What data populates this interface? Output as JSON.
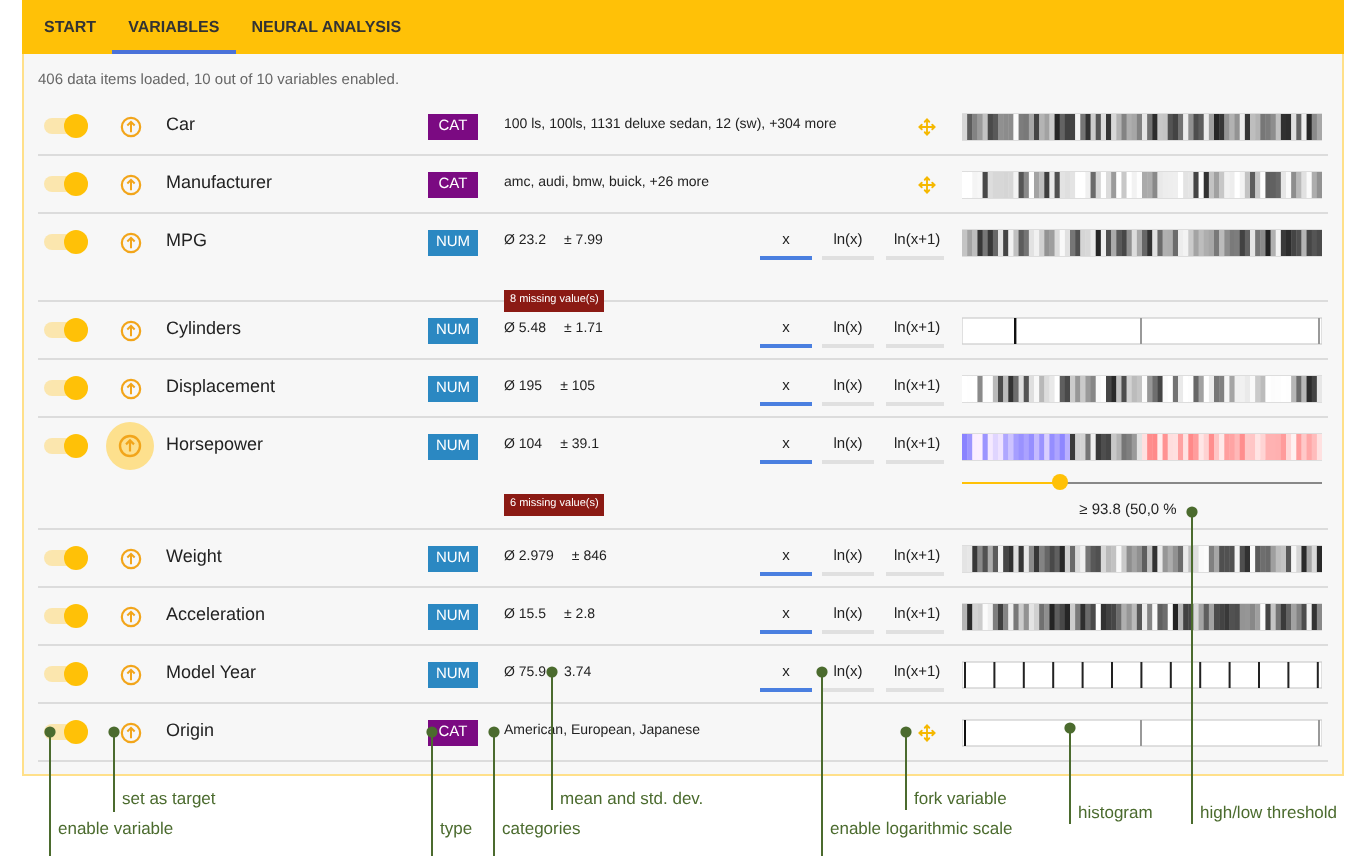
{
  "tabs": [
    {
      "label": "START",
      "selected": false
    },
    {
      "label": "VARIABLES",
      "selected": true
    },
    {
      "label": "NEURAL ANALYSIS",
      "selected": false
    }
  ],
  "status": "406 data items loaded, 10 out of 10 variables enabled.",
  "variables": [
    {
      "name": "Car",
      "type": "CAT",
      "kind": "categorical",
      "enabled": true,
      "target": false,
      "categories": "100 ls, 100ls, 1131 deluxe sedan, 12 (sw), +304 more"
    },
    {
      "name": "Manufacturer",
      "type": "CAT",
      "kind": "categorical",
      "enabled": true,
      "target": false,
      "categories": "amc, audi, bmw, buick, +26 more"
    },
    {
      "name": "MPG",
      "type": "NUM",
      "kind": "numeric",
      "enabled": true,
      "target": false,
      "mean": "Ø 23.2",
      "std": "± 7.99",
      "missing": "8 missing value(s)",
      "scales": [
        {
          "label": "x",
          "selected": true
        },
        {
          "label": "ln(x)",
          "selected": false
        },
        {
          "label": "ln(x+1)",
          "selected": false
        }
      ]
    },
    {
      "name": "Cylinders",
      "type": "NUM",
      "kind": "numeric",
      "enabled": true,
      "target": false,
      "mean": "Ø 5.48",
      "std": "± 1.71",
      "scales": [
        {
          "label": "x",
          "selected": true
        },
        {
          "label": "ln(x)",
          "selected": false
        },
        {
          "label": "ln(x+1)",
          "selected": false
        }
      ]
    },
    {
      "name": "Displacement",
      "type": "NUM",
      "kind": "numeric",
      "enabled": true,
      "target": false,
      "mean": "Ø 195",
      "std": "± 105",
      "scales": [
        {
          "label": "x",
          "selected": true
        },
        {
          "label": "ln(x)",
          "selected": false
        },
        {
          "label": "ln(x+1)",
          "selected": false
        }
      ]
    },
    {
      "name": "Horsepower",
      "type": "NUM",
      "kind": "numeric",
      "enabled": true,
      "target": true,
      "mean": "Ø 104",
      "std": "± 39.1",
      "missing": "6 missing value(s)",
      "scales": [
        {
          "label": "x",
          "selected": true
        },
        {
          "label": "ln(x)",
          "selected": false
        },
        {
          "label": "ln(x+1)",
          "selected": false
        }
      ],
      "threshold": {
        "level": 0.27,
        "reading": "≥ 93.8 (50,0 %"
      }
    },
    {
      "name": "Weight",
      "type": "NUM",
      "kind": "numeric",
      "enabled": true,
      "target": false,
      "mean": "Ø 2.979",
      "std": "± 846",
      "scales": [
        {
          "label": "x",
          "selected": true
        },
        {
          "label": "ln(x)",
          "selected": false
        },
        {
          "label": "ln(x+1)",
          "selected": false
        }
      ]
    },
    {
      "name": "Acceleration",
      "type": "NUM",
      "kind": "numeric",
      "enabled": true,
      "target": false,
      "mean": "Ø 15.5",
      "std": "± 2.8",
      "scales": [
        {
          "label": "x",
          "selected": true
        },
        {
          "label": "ln(x)",
          "selected": false
        },
        {
          "label": "ln(x+1)",
          "selected": false
        }
      ]
    },
    {
      "name": "Model Year",
      "type": "NUM",
      "kind": "numeric",
      "enabled": true,
      "target": false,
      "mean": "Ø 75.9",
      "std": "3.74",
      "scales": [
        {
          "label": "x",
          "selected": true
        },
        {
          "label": "ln(x)",
          "selected": false
        },
        {
          "label": "ln(x+1)",
          "selected": false
        }
      ]
    },
    {
      "name": "Origin",
      "type": "CAT",
      "kind": "categorical",
      "enabled": true,
      "target": false,
      "categories": "American, European, Japanese"
    }
  ],
  "annotations": [
    "set as target",
    "mean and std. dev.",
    "fork variable",
    "histogram",
    "high/low threshold",
    "enable variable",
    "type",
    "categories",
    "enable logarithmic scale"
  ]
}
